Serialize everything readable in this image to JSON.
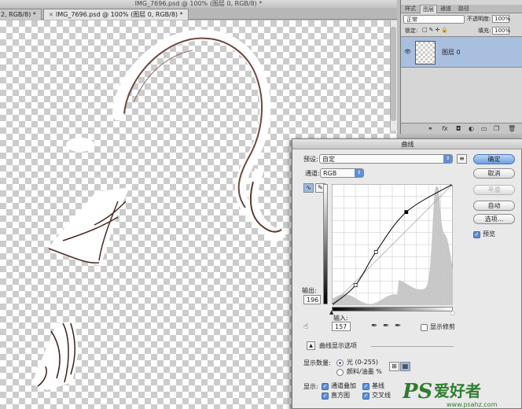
{
  "window": {
    "title": "IMG_7696.psd @ 100% (图层 0, RGB/8) *"
  },
  "doc_tabs": [
    {
      "label": "2, RGB/8) *",
      "active": false
    },
    {
      "label": "IMG_7696.psd @ 100% (图层 0, RGB/8) *",
      "active": true
    }
  ],
  "layers_panel": {
    "tabs": [
      "样式",
      "图层",
      "通道",
      "路径"
    ],
    "active_tab": "图层",
    "blend_mode": "正常",
    "opacity_label": "不透明度:",
    "opacity_value": "100%",
    "lock_label": "锁定:",
    "fill_label": "填充:",
    "fill_value": "100%",
    "layer": {
      "name": "图层 0",
      "visible_icon": "eye-icon"
    },
    "bottom_icons": [
      "link-icon",
      "fx-icon",
      "mask-icon",
      "adjustment-icon",
      "folder-icon",
      "new-layer-icon",
      "trash-icon"
    ]
  },
  "curves_dialog": {
    "title": "曲线",
    "preset_label": "预设:",
    "preset_value": "自定",
    "channel_label": "通道:",
    "channel_value": "RGB",
    "output_label": "输出:",
    "output_value": "196",
    "input_label": "输入:",
    "input_value": "157",
    "show_clipping_label": "显示修剪",
    "curve_display_options_label": "曲线显示选项",
    "show_amount_label": "显示数量:",
    "light_option": "光 (0-255)",
    "pigment_option": "颜料/油墨 %",
    "show_label": "显示:",
    "channel_overlays": "通道叠加",
    "baseline": "基线",
    "histogram": "直方图",
    "intersection_line": "交叉线",
    "buttons": {
      "ok": "确定",
      "cancel": "取消",
      "smooth": "平滑",
      "auto": "自动",
      "options": "选项..."
    },
    "preview_label": "预览"
  },
  "chart_data": {
    "type": "line",
    "title": "",
    "xlabel": "输入",
    "ylabel": "输出",
    "xlim": [
      0,
      255
    ],
    "ylim": [
      0,
      255
    ],
    "grid": true,
    "control_points": [
      [
        0,
        0
      ],
      [
        50,
        42
      ],
      [
        93,
        112
      ],
      [
        157,
        196
      ],
      [
        255,
        255
      ]
    ],
    "selected_point": [
      157,
      196
    ],
    "histogram": {
      "peak_input": 220,
      "description_color": "#c8c8c8"
    }
  },
  "watermark": {
    "brand": "PS",
    "text": "爱好者",
    "url": "www.psahz.com"
  }
}
